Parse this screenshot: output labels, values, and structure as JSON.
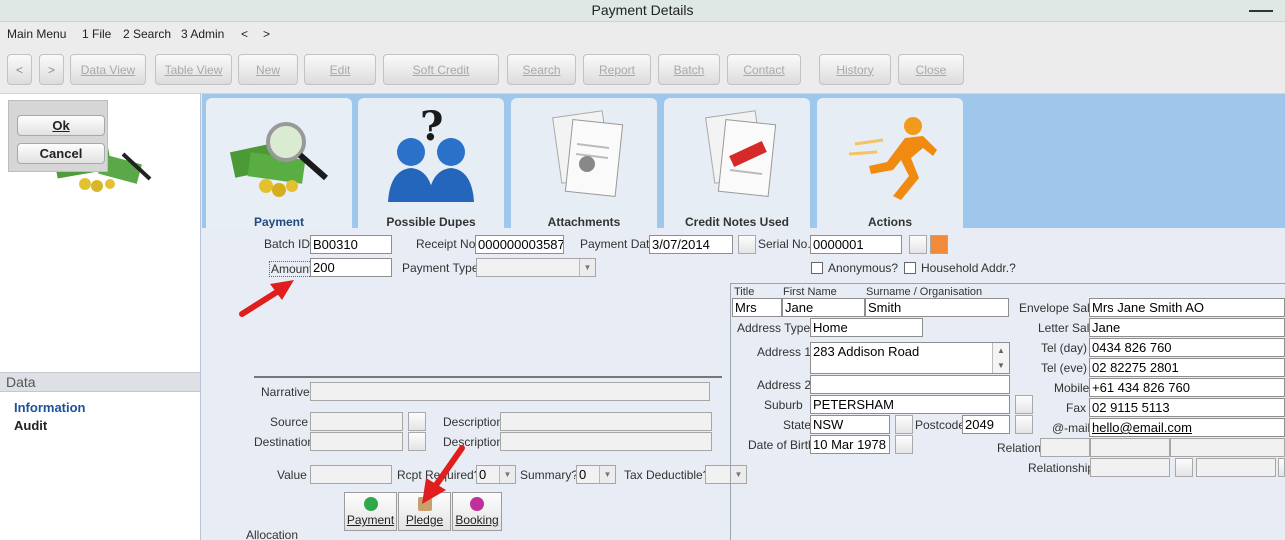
{
  "window": {
    "title": "Payment Details"
  },
  "menu": {
    "items": [
      "Main Menu",
      "1 File",
      "2 Search",
      "3 Admin",
      "<",
      ">"
    ]
  },
  "toolbar": {
    "back": "<",
    "forward": ">",
    "buttons": [
      "Data View",
      "Table View",
      "New",
      "Edit",
      "Soft Credit",
      "Search",
      "Report",
      "Batch",
      "Contact",
      "History",
      "Close"
    ]
  },
  "dialog": {
    "ok": "Ok",
    "cancel": "Cancel"
  },
  "left_nav": {
    "header": "Data",
    "links": [
      "Information",
      "Audit"
    ]
  },
  "tabs": [
    {
      "label": "Payment",
      "icon": "money-magnifier-icon"
    },
    {
      "label": "Possible Dupes",
      "icon": "people-question-icon"
    },
    {
      "label": "Attachments",
      "icon": "invoice-pin-icon"
    },
    {
      "label": "Credit Notes Used",
      "icon": "invoice-credit-icon"
    },
    {
      "label": "Actions",
      "icon": "running-man-icon"
    }
  ],
  "form": {
    "batch_id_label": "Batch ID",
    "batch_id": "B00310",
    "receipt_no_label": "Receipt No.",
    "receipt_no": "000000003587",
    "payment_date_label": "Payment Date",
    "payment_date": "3/07/2014",
    "serial_no_label": "Serial No.",
    "serial_no": "0000001",
    "amount_label": "Amount",
    "amount": "200",
    "payment_type_label": "Payment Type",
    "payment_type": "",
    "anonymous_label": "Anonymous?",
    "household_label": "Household Addr.?",
    "narrative_label": "Narrative",
    "source_label": "Source",
    "destination_label": "Destination",
    "description_label": "Description",
    "description2_label": "Description",
    "value_label": "Value",
    "rcpt_required_label": "Rcpt Required?",
    "rcpt_required": "0",
    "summary_label": "Summary?",
    "summary": "0",
    "tax_deductible_label": "Tax Deductible?",
    "allocation_label": "Allocation"
  },
  "contact": {
    "title_label": "Title",
    "title": "Mrs",
    "first_name_label": "First Name",
    "first_name": "Jane",
    "surname_label": "Surname / Organisation",
    "surname": "Smith",
    "address_type_label": "Address Type",
    "address_type": "Home",
    "address1_label": "Address 1",
    "address1": "283 Addison Road",
    "address2_label": "Address 2",
    "address2": "",
    "suburb_label": "Suburb",
    "suburb": "PETERSHAM",
    "state_label": "State",
    "state": "NSW",
    "postcode_label": "Postcode",
    "postcode": "2049",
    "dob_label": "Date of Birth",
    "dob": "10 Mar 1978",
    "envelope_label": "Envelope Sal.",
    "envelope": "Mrs Jane Smith AO",
    "letter_label": "Letter Sal.",
    "letter": "Jane",
    "tel_day_label": "Tel (day)",
    "tel_day": "0434 826 760",
    "tel_eve_label": "Tel (eve)",
    "tel_eve": "02 82275 2801",
    "mobile_label": "Mobile",
    "mobile": "+61 434 826 760",
    "fax_label": "Fax",
    "fax": "02 9115 5113",
    "email_label": "@-mail",
    "email": "hello@email.com",
    "relation_label": "Relation",
    "relationship_label": "Relationship"
  },
  "bottom_buttons": [
    {
      "label": "Payment",
      "icon": "dollar-icon",
      "color": "#2fa84a"
    },
    {
      "label": "Pledge",
      "icon": "pledge-icon",
      "color": "#c8a070"
    },
    {
      "label": "Booking",
      "icon": "booking-icon",
      "color": "#c0309a"
    }
  ],
  "colors": {
    "tab_strip": "#9fc7ec",
    "form_bg": "#e8ecf4",
    "arrow": "#e01e1e",
    "active_tab_label": "#20497d"
  }
}
